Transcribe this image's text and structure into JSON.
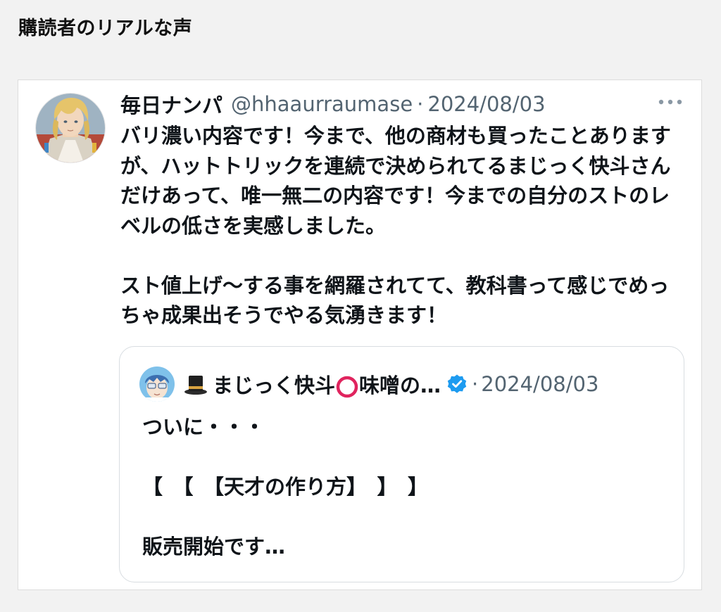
{
  "section": {
    "heading": "購読者のリアルな声"
  },
  "tweet": {
    "display_name": "毎日ナンパ",
    "handle": "@hhaaurraumase",
    "separator": "·",
    "date": "2024/08/03",
    "more_icon": "more-horizontal-icon",
    "body": {
      "paragraph1": "バリ濃い内容です！今まで、他の商材も買ったことありますが、ハットトリックを連続で決められてるまじっく快斗さんだけあって、唯一無二の内容です！今までの自分のストのレベルの低さを実感しました。",
      "paragraph2": "スト値上げ〜する事を網羅されてて、教科書って感じでめっちゃ成果出そうでやる気湧きます！"
    }
  },
  "quote": {
    "name_prefix_icon": "top-hat-icon",
    "name_part1": "まじっく快斗",
    "name_circle_icon": "red-circle-icon",
    "name_part2": "味噌の…",
    "verified_icon": "verified-badge-icon",
    "separator": "·",
    "date": "2024/08/03",
    "body": {
      "line1": "ついに・・・",
      "line2": "【　【　【天才の作り方】　】　】",
      "line3": "販売開始です…"
    }
  },
  "colors": {
    "page_background": "#f2f2f2",
    "card_background": "#ffffff",
    "text_primary": "#0f1419",
    "text_secondary": "#536471",
    "verified_blue": "#1d9bf0",
    "circle_red": "#e0245e"
  }
}
